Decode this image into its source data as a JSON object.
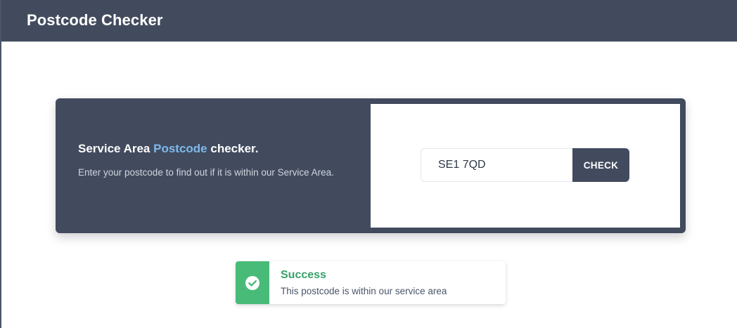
{
  "header": {
    "title": "Postcode Checker"
  },
  "checker": {
    "heading_prefix": "Service Area ",
    "heading_accent": "Postcode",
    "heading_suffix": " checker.",
    "description": "Enter your postcode to find out if it is within our Service Area.",
    "postcode_value": "SE1 7QD",
    "button_label": "CHECK"
  },
  "result": {
    "status": "success",
    "icon": "check-circle-icon",
    "title": "Success",
    "message": "This postcode is within our service area"
  },
  "colors": {
    "header_bg": "#424b5e",
    "accent_blue": "#7db9ec",
    "success_green": "#48bb78",
    "success_text": "#38a169"
  }
}
